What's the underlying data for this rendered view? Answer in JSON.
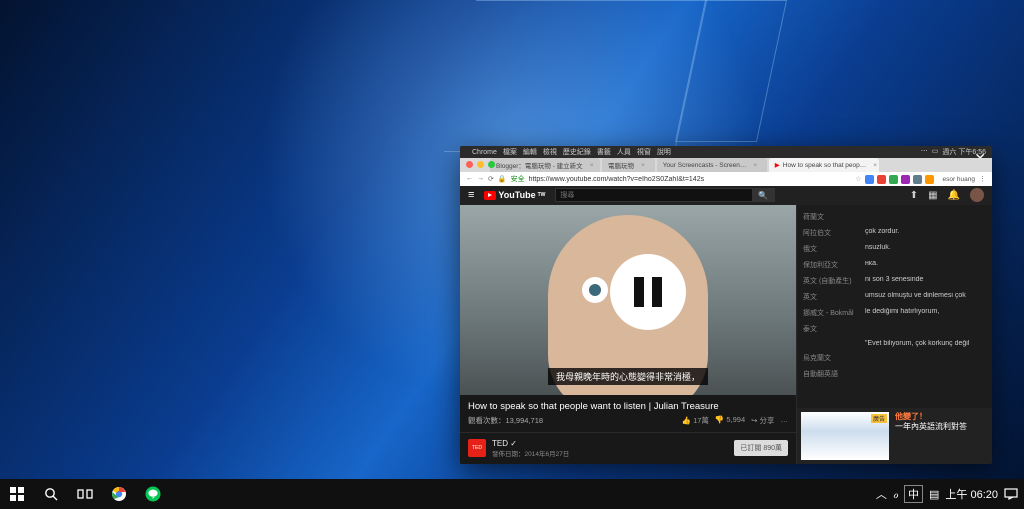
{
  "taskbar": {
    "ime": "中",
    "clock_prefix": "上午",
    "clock_time": "06:20"
  },
  "mac_menu": {
    "app": "Chrome",
    "items": [
      "檔案",
      "編輯",
      "檢視",
      "歷史紀錄",
      "書籤",
      "人員",
      "視窗",
      "說明"
    ],
    "clock": "週六 下午6:56"
  },
  "tabs": [
    {
      "label": "Blogger：電腦玩物 - 建立新文"
    },
    {
      "label": "電腦玩物"
    },
    {
      "label": "Your Screencasts - Screen…"
    },
    {
      "label": "How to speak so that peop…"
    }
  ],
  "url": {
    "secure_label": "安全",
    "address": "https://www.youtube.com/watch?v=eIho2S0ZahI&t=142s"
  },
  "profile_name": "esor huang",
  "youtube": {
    "brand": "YouTube",
    "brand_sup": "TW",
    "search_placeholder": "搜尋",
    "caption_text": "我母親晚年時的心態變得非常消極，",
    "video_title": "How to speak so that people want to listen | Julian Treasure",
    "views_label": "觀看次數：13,994,718",
    "like_count": "17萬",
    "dislike_count": "5,994",
    "share_label": "分享",
    "more_label": "…",
    "channel_name": "TED",
    "verified": "✓",
    "publish_label": "發佈日期：2014年6月27日",
    "subscribe_label": "已訂閱 890萬",
    "channel_badge": "TED"
  },
  "captions_list": [
    {
      "lang": "荷蘭文",
      "text": ""
    },
    {
      "lang": "阿拉伯文",
      "text": "çok zordur."
    },
    {
      "lang": "俄文",
      "text": "nsuzluk."
    },
    {
      "lang": "保加利亞文",
      "text": "нка."
    },
    {
      "lang": "英文 (自動產生)",
      "text": "ni son 3 senesinde"
    },
    {
      "lang": "英文",
      "text": "umsuz olmuştu ve dinlemesi çok"
    },
    {
      "lang": "挪威文 - Bokmål",
      "text": "le dediğimi hatırlıyorum,"
    },
    {
      "lang": "泰文",
      "text": ""
    },
    {
      "lang": "",
      "text": "\"Evet biliyorum, çok korkunç değil"
    },
    {
      "lang": "烏克蘭文",
      "text": ""
    },
    {
      "lang": "自動翻英語",
      "text": ""
    }
  ],
  "recommended": {
    "ad_label": "廣告",
    "line1": "他變了！",
    "line2": "一年內英語流利對答"
  }
}
